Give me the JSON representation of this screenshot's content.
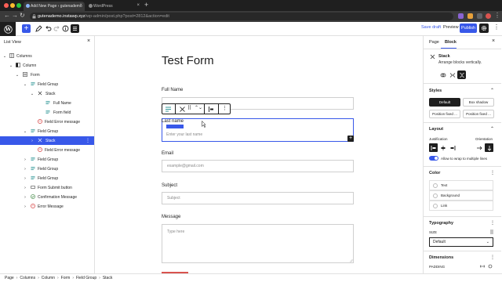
{
  "browser": {
    "active_tab_title": "Add New Page ‹ gutenademo",
    "second_tab_title": "WordPress",
    "url_host": "gutenademo.instawp.xyz",
    "url_path": "/wp-admin/post.php?post=2812&action=edit"
  },
  "header": {
    "save_draft": "Save draft",
    "preview": "Preview",
    "publish": "Publish"
  },
  "listview": {
    "title": "List View",
    "items": [
      {
        "label": "Columns"
      },
      {
        "label": "Column"
      },
      {
        "label": "Form"
      },
      {
        "label": "Field Group"
      },
      {
        "label": "Stack"
      },
      {
        "label": "Full Name"
      },
      {
        "label": "Form field"
      },
      {
        "label": "Field Error message"
      },
      {
        "label": "Field Group"
      },
      {
        "label": "Stack"
      },
      {
        "label": "Field Error message"
      },
      {
        "label": "Field Group"
      },
      {
        "label": "Field Group"
      },
      {
        "label": "Field Group"
      },
      {
        "label": "Form Submit button"
      },
      {
        "label": "Confirmation Message"
      },
      {
        "label": "Error Message"
      }
    ]
  },
  "canvas": {
    "title": "Test Form",
    "full_name_label": "Full Name",
    "last_name_label": "Last name",
    "last_name_placeholder": "Enter your last name",
    "email_label": "Email",
    "email_placeholder": "example@gmail.com",
    "subject_label": "Subject",
    "subject_placeholder": "Subject",
    "message_label": "Message",
    "message_placeholder": "Type here"
  },
  "settings": {
    "tab_page": "Page",
    "tab_block": "Block",
    "block_name": "Stack",
    "block_desc": "Arrange blocks vertically.",
    "styles_title": "Styles",
    "styles": [
      "Default",
      "Box shadow",
      "Position fixed ...",
      "Position fixed ..."
    ],
    "layout_title": "Layout",
    "justification_label": "Justification",
    "orientation_label": "Orientation",
    "wrap_label": "Allow to wrap to multiple lines",
    "color_title": "Color",
    "colors": [
      "Text",
      "Background",
      "Link"
    ],
    "typography_title": "Typography",
    "size_label": "SIZE",
    "size_value": "Default",
    "dimensions_title": "Dimensions",
    "padding_label": "PADDING"
  },
  "breadcrumb": [
    "Page",
    "Columns",
    "Column",
    "Form",
    "Field Group",
    "Stack"
  ],
  "colors": {
    "accent": "#3858e9",
    "dark": "#1e1e1e",
    "submit": "#d9534f"
  }
}
